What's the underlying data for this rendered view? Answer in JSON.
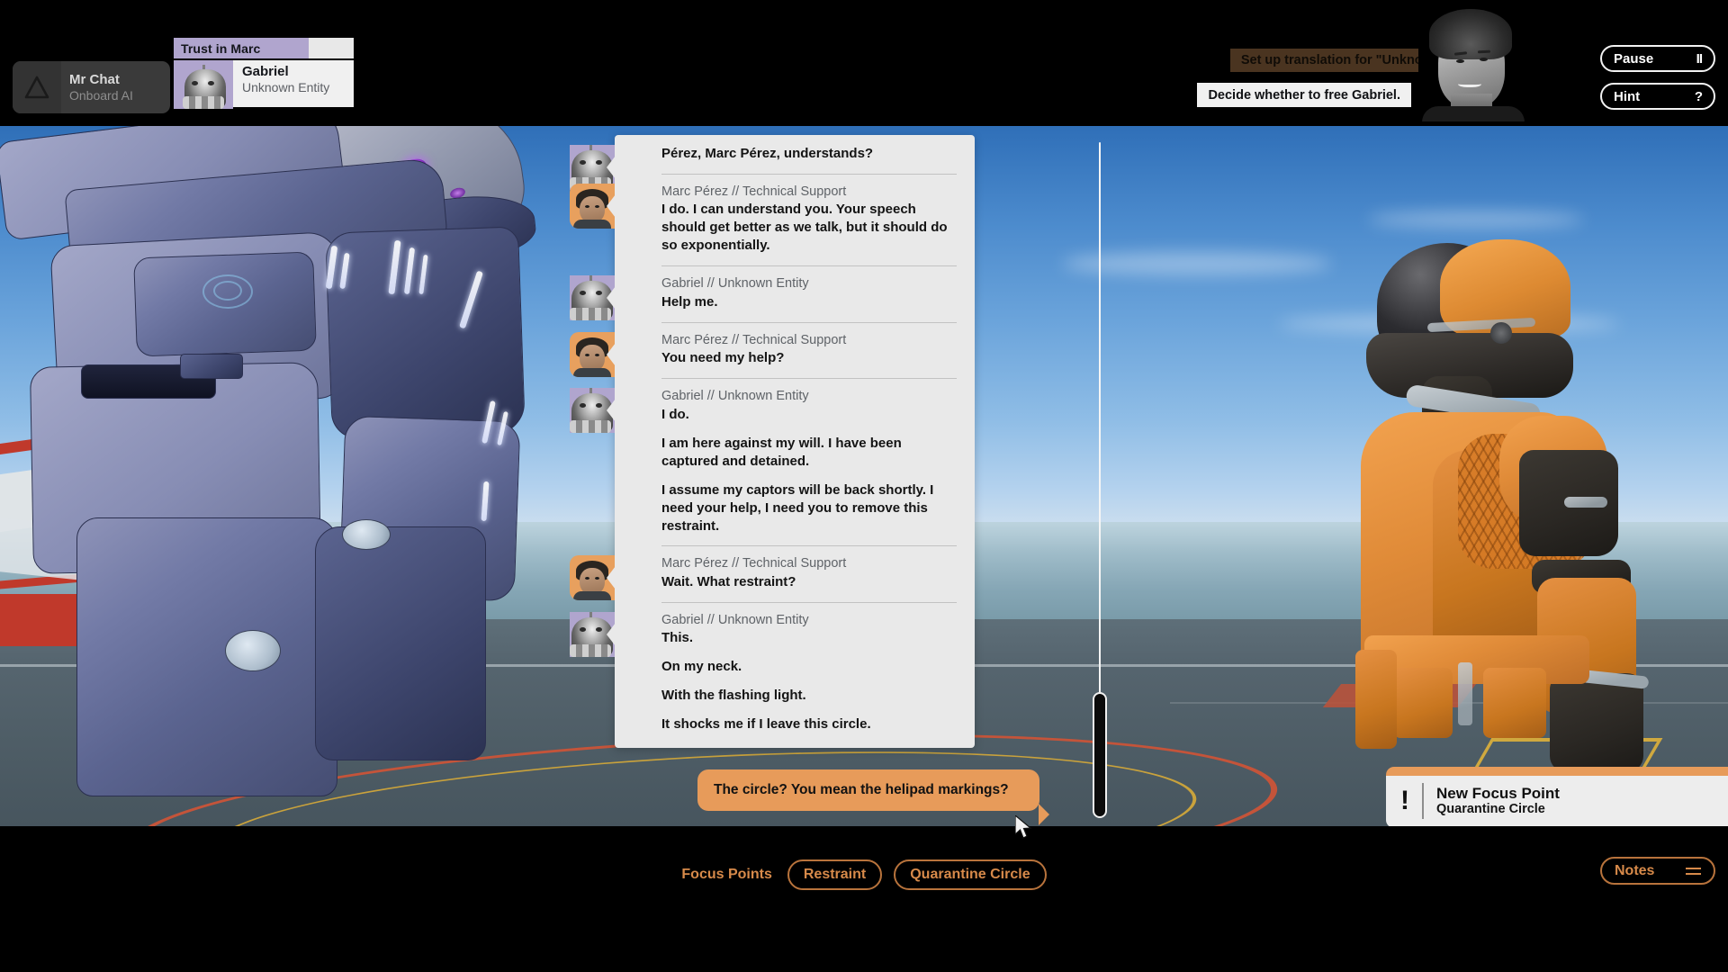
{
  "hud": {
    "assistant": {
      "name": "Mr Chat",
      "role": "Onboard AI",
      "icon": "triangle-icon"
    },
    "contact": {
      "trust_label": "Trust in Marc",
      "trust_percent": 75,
      "name": "Gabriel",
      "role": "Unknown Entity"
    },
    "objective_completed": "Set up translation for \"Unknown Entity\".",
    "objective_current": "Decide whether to free Gabriel.",
    "pause_label": "Pause",
    "pause_glyph": "II",
    "hint_label": "Hint",
    "hint_glyph": "?"
  },
  "chat": {
    "messages": [
      {
        "speaker": "",
        "side": "alien",
        "avatar": "alien-avatar",
        "lines": [
          "Pérez, Marc Pérez, understands?"
        ]
      },
      {
        "speaker": "Marc Pérez // Technical Support",
        "side": "human",
        "avatar": "human-avatar",
        "lines": [
          "I do. I can understand you. Your speech should get better as we talk, but it should do so exponentially."
        ]
      },
      {
        "speaker": "Gabriel // Unknown Entity",
        "side": "alien",
        "avatar": "alien-avatar",
        "lines": [
          "Help me."
        ]
      },
      {
        "speaker": "Marc Pérez // Technical Support",
        "side": "human",
        "avatar": "human-avatar",
        "lines": [
          "You need my help?"
        ]
      },
      {
        "speaker": "Gabriel // Unknown Entity",
        "side": "alien",
        "avatar": "alien-avatar",
        "lines": [
          "I do.",
          "I am here against my will. I have been captured and detained.",
          "I assume my captors will be back shortly. I need your help, I need you to remove this restraint."
        ]
      },
      {
        "speaker": "Marc Pérez // Technical Support",
        "side": "human",
        "avatar": "human-avatar",
        "lines": [
          "Wait. What restraint?"
        ]
      },
      {
        "speaker": "Gabriel // Unknown Entity",
        "side": "alien",
        "avatar": "alien-avatar",
        "lines": [
          "This.",
          "On my neck.",
          "With the flashing light.",
          "It shocks me if I leave this circle."
        ]
      }
    ],
    "player_reply": "The circle? You mean the helipad markings?"
  },
  "toast": {
    "badge": "!",
    "title": "New Focus Point",
    "subtitle": "Quarantine Circle"
  },
  "bottom": {
    "focus_points_label": "Focus Points",
    "chips": [
      "Restraint",
      "Quarantine Circle"
    ],
    "notes_label": "Notes",
    "notes_icon": "hamburger-icon"
  },
  "colors": {
    "accent_orange": "#d78a4a",
    "chip_border": "#b8733c",
    "trust_fill": "#b0a5ce",
    "objective_done_bg": "#4a3420",
    "reply_bubble": "#e79b5a",
    "panel_bg": "#e9e9e9"
  }
}
